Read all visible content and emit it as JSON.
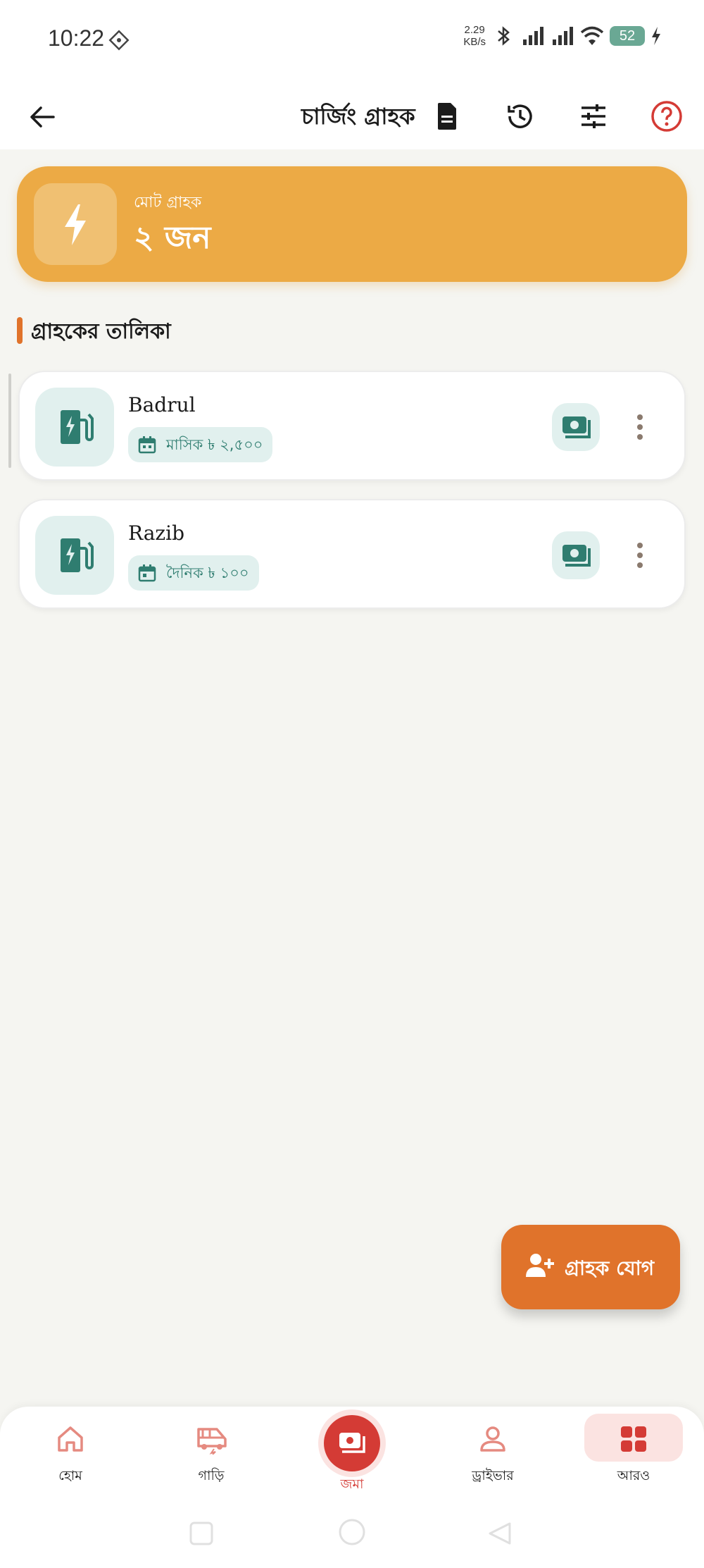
{
  "status_bar": {
    "time": "10:22",
    "speed_value": "2.29",
    "speed_unit": "KB/s",
    "battery": "52",
    "icons": [
      "diamond-icon",
      "bluetooth-icon",
      "signal-icon",
      "signal-icon",
      "wifi-icon",
      "charging-icon"
    ]
  },
  "app_bar": {
    "title": "চার্জিং গ্রাহক",
    "icons": [
      "back-arrow-icon",
      "document-icon",
      "history-icon",
      "tune-icon",
      "help-icon"
    ]
  },
  "summary": {
    "label": "মোট গ্রাহক",
    "value": "২ জন",
    "icon": "bolt-icon"
  },
  "section": {
    "title": "গ্রাহকের তালিকা"
  },
  "customers": [
    {
      "name": "Badrul",
      "plan": "মাসিক ৳ ২,৫০০",
      "icon": "charging-station-icon"
    },
    {
      "name": "Razib",
      "plan": "দৈনিক ৳ ১০০",
      "icon": "charging-station-icon"
    }
  ],
  "fab": {
    "label": "গ্রাহক যোগ",
    "icon": "person-add-icon"
  },
  "bottom_nav": {
    "items": [
      {
        "label": "হোম",
        "icon": "home-icon"
      },
      {
        "label": "গাড়ি",
        "icon": "vehicle-icon"
      },
      {
        "label": "জমা",
        "icon": "cash-icon"
      },
      {
        "label": "ড্রাইভার",
        "icon": "person-icon"
      },
      {
        "label": "আরও",
        "icon": "grid-icon"
      }
    ]
  },
  "colors": {
    "accent_orange": "#e0732b",
    "summary_amber": "#ecaa45",
    "teal": "#2f7d70",
    "teal_light": "#e1f0ee",
    "nav_red": "#d43b35"
  }
}
